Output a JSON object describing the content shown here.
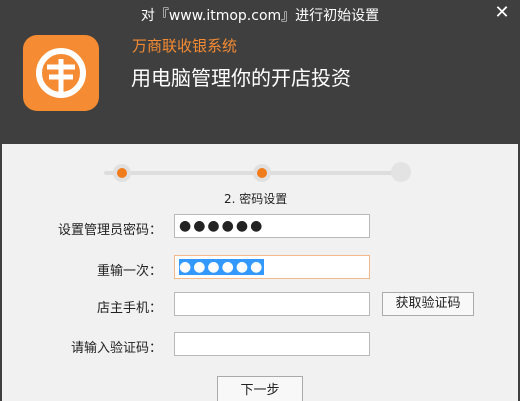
{
  "window": {
    "title": "对『www.itmop.com』进行初始设置",
    "close_glyph": "✕"
  },
  "header": {
    "app_name": "万商联收银系统",
    "tagline": "用电脑管理你的开店投资",
    "icon": "brand-logo-icon",
    "brand_color": "#f58b32"
  },
  "steps": {
    "current_label": "2. 密码设置",
    "total": 3,
    "current": 2
  },
  "form": {
    "admin_password_label": "设置管理员密码：",
    "admin_password_value": "●●●●●●",
    "repeat_label": "重输一次：",
    "repeat_value": "●●●●●●",
    "phone_label": "店主手机：",
    "phone_value": "",
    "code_label": "请输入验证码：",
    "code_value": "",
    "get_code_button": "获取验证码"
  },
  "footer": {
    "next_button": "下一步"
  }
}
